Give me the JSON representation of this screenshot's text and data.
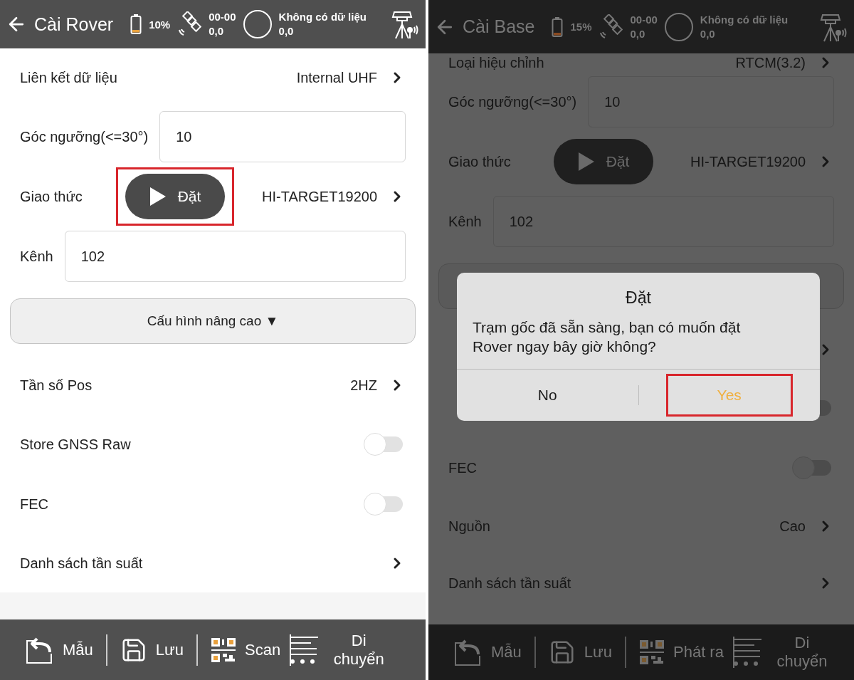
{
  "panels": [
    {
      "dimmed": false,
      "header": {
        "title": "Cài Rover",
        "battery": "10%",
        "satellites": [
          "00-00",
          "0,0"
        ],
        "status": [
          "Không có dữ liệu",
          "0,0"
        ]
      },
      "rows": [
        {
          "kind": "link",
          "label": "Liên kết dữ liệu",
          "value": "Internal UHF"
        },
        {
          "kind": "input",
          "label": "Góc ngưỡng(<=30°)",
          "value": "10"
        },
        {
          "kind": "protocol",
          "label": "Giao thức",
          "action": "Đặt",
          "value": "HI-TARGET19200",
          "highlighted": true
        },
        {
          "kind": "input",
          "label": "Kênh",
          "value": "102"
        },
        {
          "kind": "button",
          "label": "Cấu hình nâng cao ▼"
        },
        {
          "kind": "link",
          "label": "Tần số Pos",
          "value": "2HZ"
        },
        {
          "kind": "toggle",
          "label": "Store GNSS Raw",
          "on": false
        },
        {
          "kind": "toggle",
          "label": "FEC",
          "on": false
        },
        {
          "kind": "link",
          "label": "Danh sách tần suất"
        }
      ],
      "toolbar": [
        {
          "kind": "template",
          "label": "Mẫu"
        },
        {
          "kind": "save",
          "label": "Lưu"
        },
        {
          "kind": "qr",
          "label": "Scan"
        },
        {
          "kind": "list",
          "label": "Di chuyển"
        }
      ]
    },
    {
      "dimmed": true,
      "header": {
        "title": "Cài Base",
        "battery": "15%",
        "satellites": [
          "00-00",
          "0,0"
        ],
        "status": [
          "Không có dữ liệu",
          "0,0"
        ]
      },
      "rows": [
        {
          "kind": "partial",
          "label": "Loại hiệu chỉnh",
          "value": "RTCM(3.2)"
        },
        {
          "kind": "input",
          "label": "Góc ngưỡng(<=30°)",
          "value": "10"
        },
        {
          "kind": "protocol",
          "label": "Giao thức",
          "action": "Đặt",
          "value": "HI-TARGET19200",
          "highlighted": false
        },
        {
          "kind": "input",
          "label": "Kênh",
          "value": "102"
        },
        {
          "kind": "button"
        },
        {
          "kind": "link"
        },
        {
          "kind": "toggle",
          "on": false
        },
        {
          "kind": "toggle",
          "label": "FEC",
          "on": false
        },
        {
          "kind": "link",
          "label": "Nguồn",
          "value": "Cao"
        },
        {
          "kind": "link",
          "label": "Danh sách tần suất"
        }
      ],
      "toolbar": [
        {
          "kind": "template",
          "label": "Mẫu"
        },
        {
          "kind": "save",
          "label": "Lưu"
        },
        {
          "kind": "qr",
          "label": "Phát ra"
        },
        {
          "kind": "list",
          "label": "Di chuyển"
        }
      ],
      "dialog": {
        "title": "Đặt",
        "message": "Trạm gốc đã sẵn sàng, bạn có muốn đặt Rover ngay bây giờ không?",
        "buttons": [
          {
            "kind": "cancel",
            "label": "No",
            "highlighted": false
          },
          {
            "kind": "confirm",
            "label": "Yes",
            "highlighted": true
          }
        ]
      }
    }
  ]
}
